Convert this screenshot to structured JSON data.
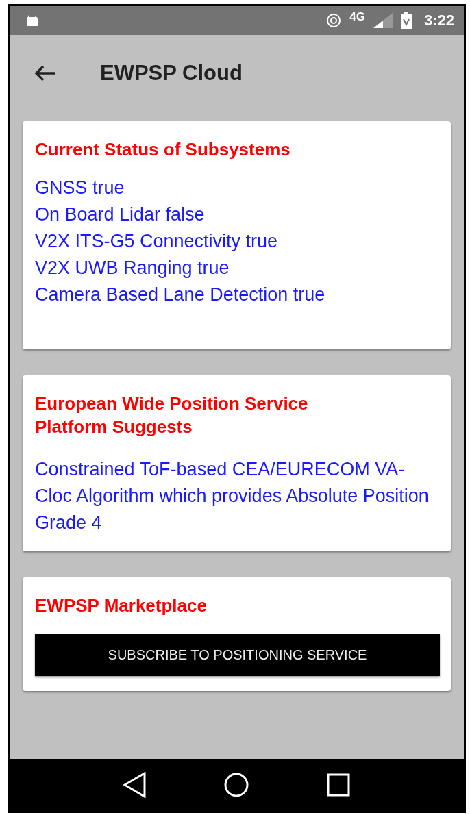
{
  "status_bar": {
    "network": "4G",
    "time": "3:22"
  },
  "app_bar": {
    "title": "EWPSP Cloud"
  },
  "cards": [
    {
      "title": "Current Status of Subsystems",
      "lines": [
        "GNSS true",
        "On Board Lidar false",
        "V2X ITS-G5 Connectivity true",
        "V2X UWB Ranging true",
        "Camera Based Lane Detection true"
      ]
    },
    {
      "title": "European Wide Position Service Platform Suggests",
      "lines": [
        "Constrained ToF-based CEA/EURECOM VA-Cloc Algorithm which provides Absolute Position Grade 4"
      ]
    },
    {
      "title": "EWPSP Marketplace",
      "button": "SUBSCRIBE TO POSITIONING SERVICE"
    }
  ]
}
